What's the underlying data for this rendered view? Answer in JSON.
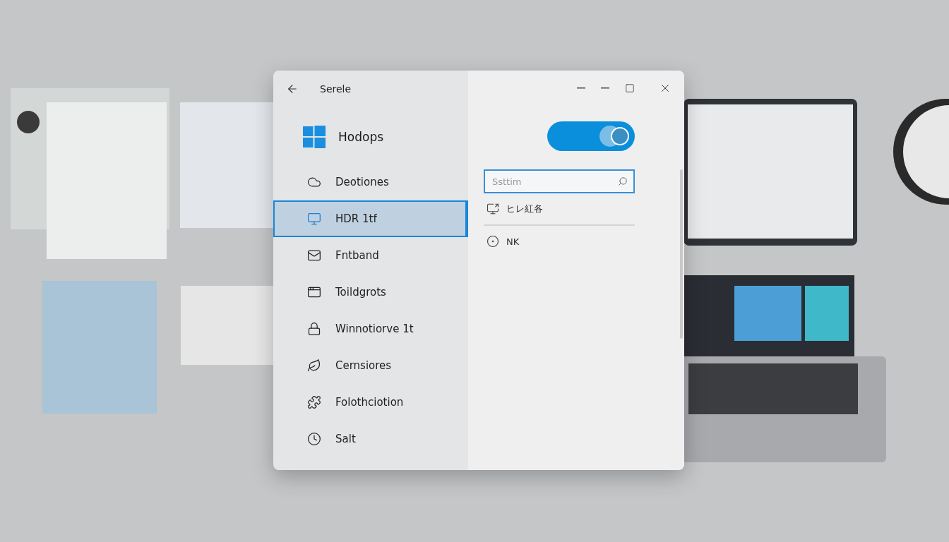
{
  "window": {
    "title": "Serele",
    "toggle": {
      "on": true
    },
    "search": {
      "placeholder": "Ssttim"
    }
  },
  "sidebar": {
    "header": "Hodops",
    "items": [
      {
        "label": "Deotiones",
        "selected": false
      },
      {
        "label": "HDR 1tf",
        "selected": true
      },
      {
        "label": "Fntband",
        "selected": false
      },
      {
        "label": "Toildgrots",
        "selected": false
      },
      {
        "label": "Winnotiorve 1t",
        "selected": false
      },
      {
        "label": "Cernsiores",
        "selected": false
      },
      {
        "label": "Folothciotion",
        "selected": false
      },
      {
        "label": "Salt",
        "selected": false
      }
    ]
  },
  "results": [
    {
      "label": "ヒレ紅各"
    },
    {
      "label": "NK"
    }
  ]
}
